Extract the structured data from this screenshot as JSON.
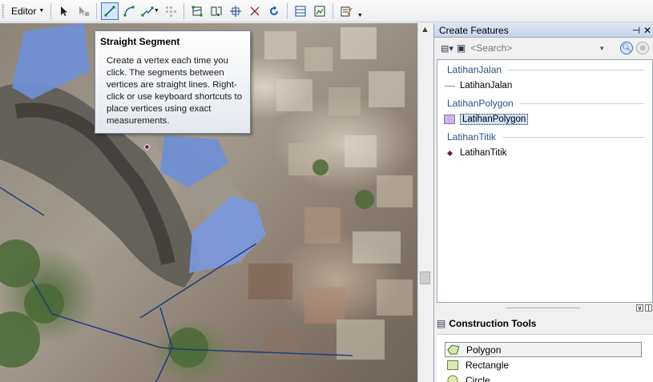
{
  "toolbar": {
    "editor_label": "Editor",
    "buttons": [
      "edit-tool",
      "edit-annotation",
      "straight-segment",
      "arc-segment",
      "trace",
      "trace-options",
      "edit-vertices",
      "reshape",
      "cut-polygons",
      "split",
      "rotate",
      "attributes",
      "sketch-properties",
      "create-features",
      "more"
    ]
  },
  "tooltip": {
    "title": "Straight Segment",
    "body": "Create a vertex each time you click. The segments between vertices are straight lines. Right-click or use keyboard shortcuts to place vertices using exact measurements."
  },
  "panel": {
    "title": "Create Features",
    "search_placeholder": "<Search>",
    "groups": [
      {
        "name": "LatihanJalan",
        "item": "LatihanJalan",
        "symbol": "line"
      },
      {
        "name": "LatihanPolygon",
        "item": "LatihanPolygon",
        "symbol": "polygon"
      },
      {
        "name": "LatihanTitik",
        "item": "LatihanTitik",
        "symbol": "point"
      }
    ],
    "construction_tools_title": "Construction Tools",
    "construction_tools": [
      "Polygon",
      "Rectangle",
      "Circle"
    ]
  },
  "colors": {
    "accent": "#3b6fc4",
    "header": "#c7d6ec",
    "group_text": "#2a4f86",
    "polygon_fill": "#c9b6e6",
    "point_fill": "#6b1d5c",
    "roof_blue": "#6f8fd6",
    "road_line": "#1f3d7a"
  }
}
